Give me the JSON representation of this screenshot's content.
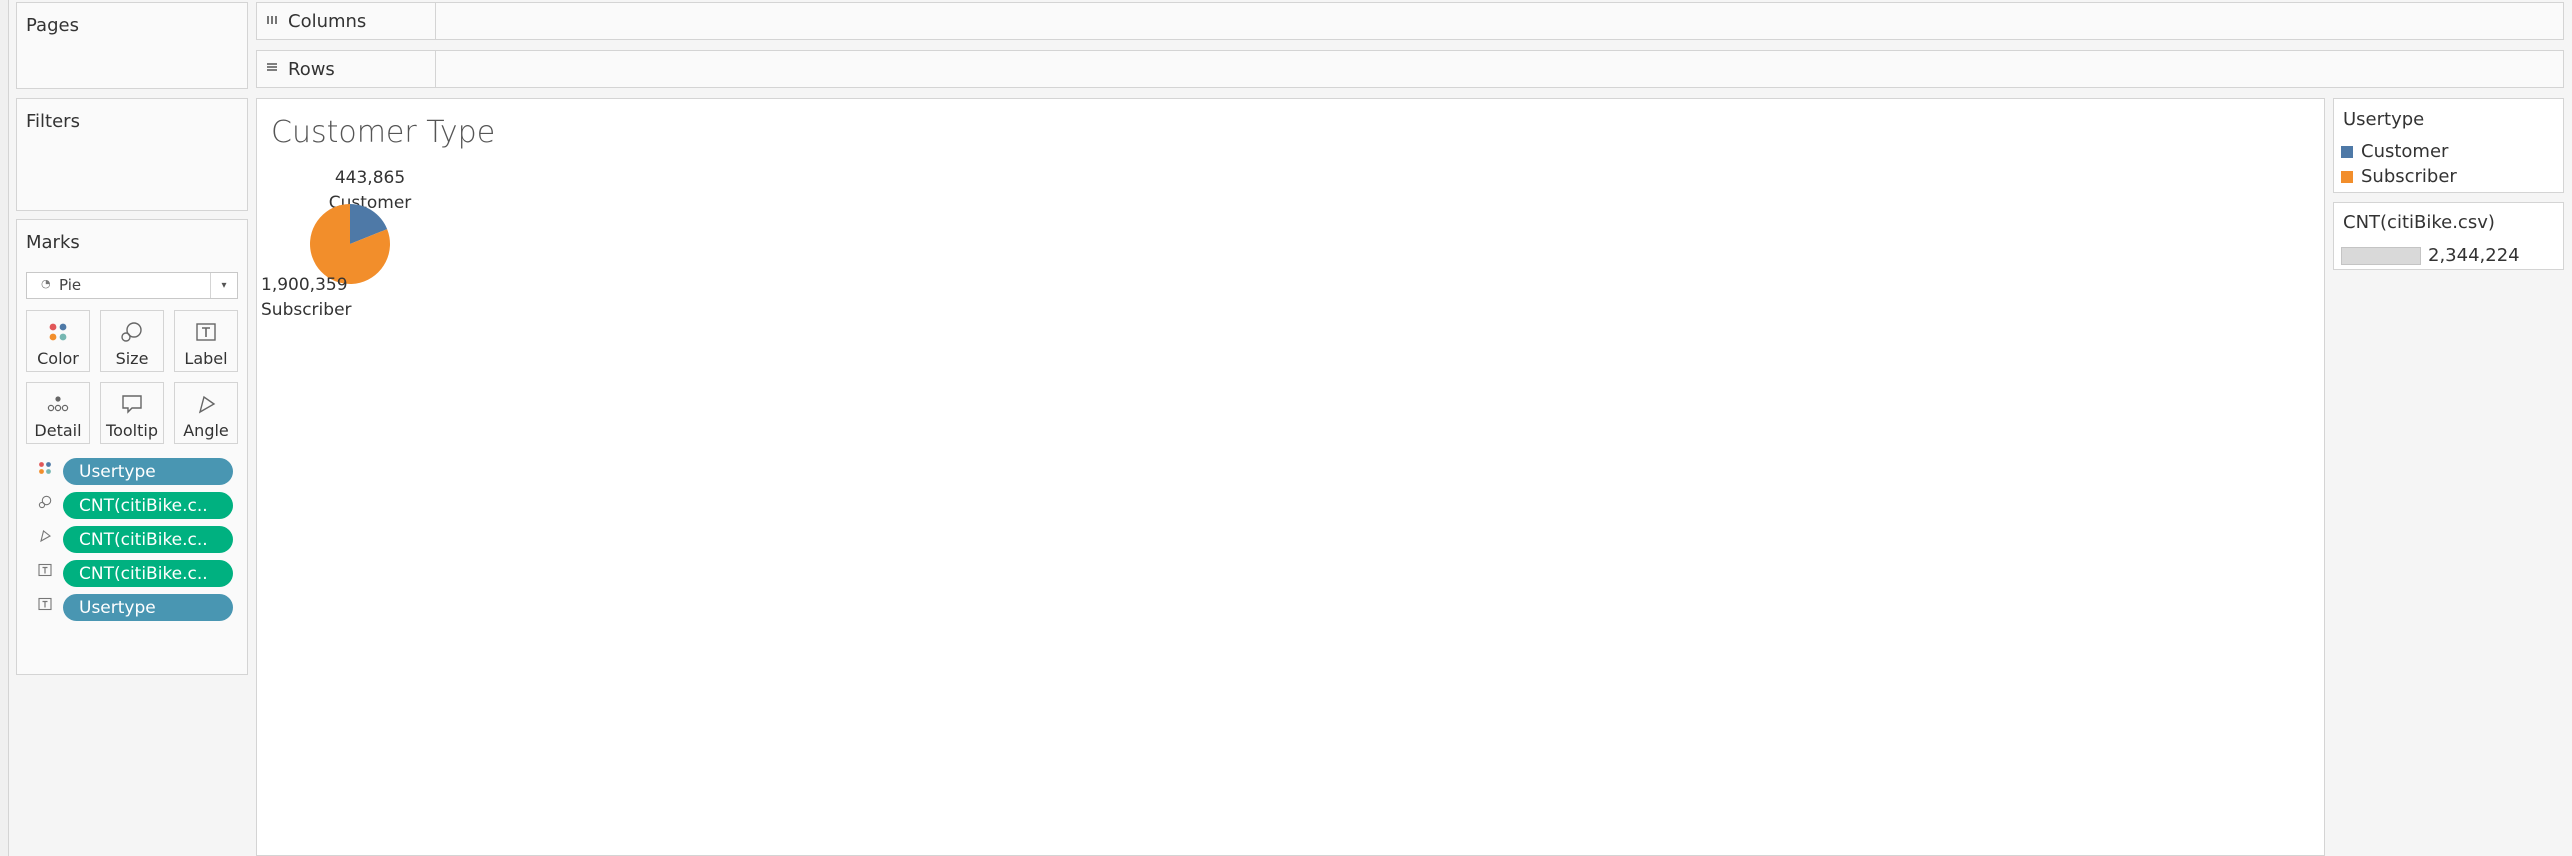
{
  "cards": {
    "pages": "Pages",
    "filters": "Filters",
    "marks": "Marks"
  },
  "shelves": {
    "columns": "Columns",
    "rows": "Rows"
  },
  "marks": {
    "mark_type": "Pie",
    "buttons": [
      "Color",
      "Size",
      "Label",
      "Detail",
      "Tooltip",
      "Angle"
    ],
    "pills": [
      {
        "label": "Usertype",
        "kind": "dimension",
        "icon": "color-icon"
      },
      {
        "label": "CNT(citiBike.c..",
        "kind": "measure",
        "icon": "size-icon"
      },
      {
        "label": "CNT(citiBike.c..",
        "kind": "measure",
        "icon": "angle-icon"
      },
      {
        "label": "CNT(citiBike.c..",
        "kind": "measure",
        "icon": "label-icon"
      },
      {
        "label": "Usertype",
        "kind": "dimension",
        "icon": "label-icon"
      }
    ]
  },
  "view": {
    "title": "Customer Type"
  },
  "legend": {
    "color_title": "Usertype",
    "color_items": [
      {
        "label": "Customer",
        "color": "#4e79a7"
      },
      {
        "label": "Subscriber",
        "color": "#f28e2b"
      }
    ],
    "size_title": "CNT(citiBike.csv)",
    "size_value": "2,344,224"
  },
  "colors": {
    "dimension_pill": "#4996b2",
    "measure_pill": "#00b180",
    "customer": "#4e79a7",
    "subscriber": "#f28e2b"
  },
  "chart_data": {
    "type": "pie",
    "title": "Customer Type",
    "categories": [
      "Customer",
      "Subscriber"
    ],
    "values": [
      443865,
      1900359
    ],
    "value_labels": [
      "443,865",
      "1,900,359"
    ],
    "colors": [
      "#4e79a7",
      "#f28e2b"
    ]
  }
}
